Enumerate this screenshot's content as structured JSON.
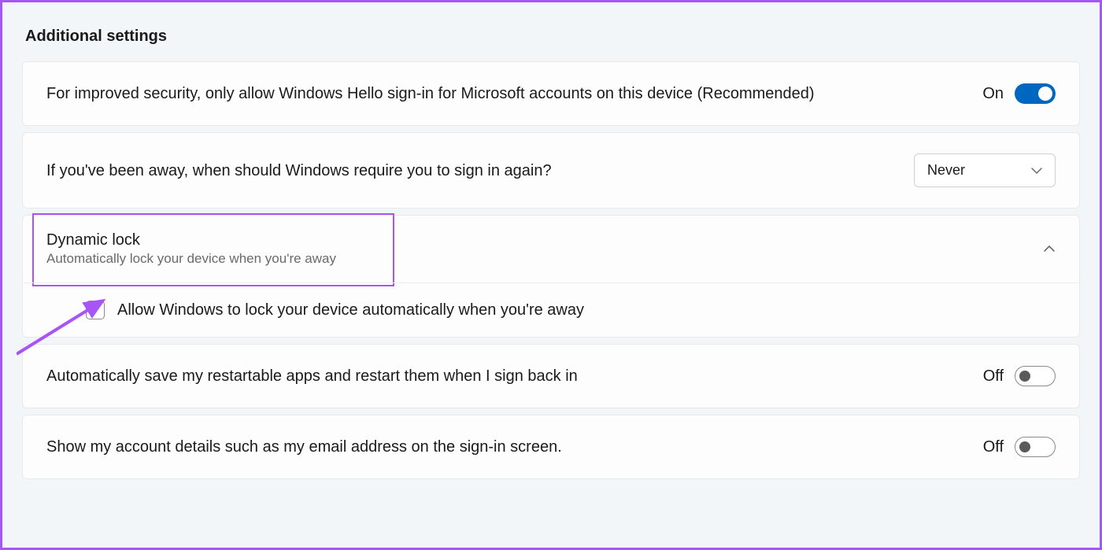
{
  "section_title": "Additional settings",
  "row1": {
    "text": "For improved security, only allow Windows Hello sign-in for Microsoft accounts on this device (Recommended)",
    "state_label": "On"
  },
  "row2": {
    "text": "If you've been away, when should Windows require you to sign in again?",
    "selected": "Never"
  },
  "dynamic_lock": {
    "title": "Dynamic lock",
    "subtitle": "Automatically lock your device when you're away",
    "checkbox_label": "Allow Windows to lock your device automatically when you're away"
  },
  "row4": {
    "text": "Automatically save my restartable apps and restart them when I sign back in",
    "state_label": "Off"
  },
  "row5": {
    "text": "Show my account details such as my email address on the sign-in screen.",
    "state_label": "Off"
  }
}
